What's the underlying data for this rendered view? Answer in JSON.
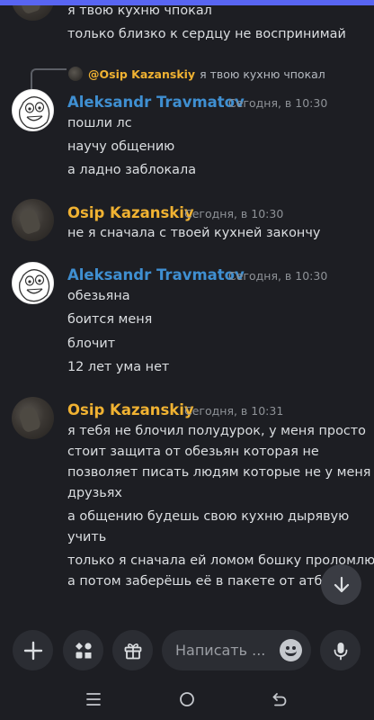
{
  "messages": {
    "top_lines": [
      "я твою кухню чпокал",
      "только близко к сердцу не воспринимай"
    ],
    "reply": {
      "name": "@Osip Kazanskiy",
      "text": "я твою кухню чпокал"
    },
    "group1": {
      "author": "Aleksandr Travmatov",
      "time": "Сегодня, в 10:30",
      "lines": [
        "пошли лс",
        "научу общению",
        "а ладно заблокала"
      ]
    },
    "group2": {
      "author": "Osip Kazanskiy",
      "time": "Сегодня, в 10:30",
      "lines": [
        "не я сначала с твоей кухней закончу"
      ]
    },
    "group3": {
      "author": "Aleksandr Travmatov",
      "time": "Сегодня, в 10:30",
      "lines": [
        "обезьяна",
        "боится меня",
        "блочит",
        "12 лет ума нет"
      ]
    },
    "group4": {
      "author": "Osip Kazanskiy",
      "time": "Сегодня, в 10:31",
      "lines": [
        "я тебя не блочил полудурок, у меня просто",
        "стоит защита от обезьян которая не",
        "позволяет писать людям которые не у меня в",
        "друзьях",
        "а общению будешь свою кухню дырявую",
        "учить",
        "только я сначала ей ломом бошку проломлю,",
        "а потом заберёшь её в пакете от атб, ок"
      ]
    }
  },
  "composer": {
    "placeholder": "Написать ..."
  },
  "icons": {
    "plus": "plus-icon",
    "apps": "apps-icon",
    "gift": "gift-icon",
    "emoji": "emoji-icon",
    "mic": "microphone-icon",
    "scroll": "arrow-down-icon",
    "recents": "recents-icon",
    "home": "home-icon",
    "back": "back-icon"
  },
  "colors": {
    "accent": "#5865f2",
    "name_blue": "#3f8fd1",
    "name_gold": "#f0b232",
    "background": "#1d1e23"
  }
}
